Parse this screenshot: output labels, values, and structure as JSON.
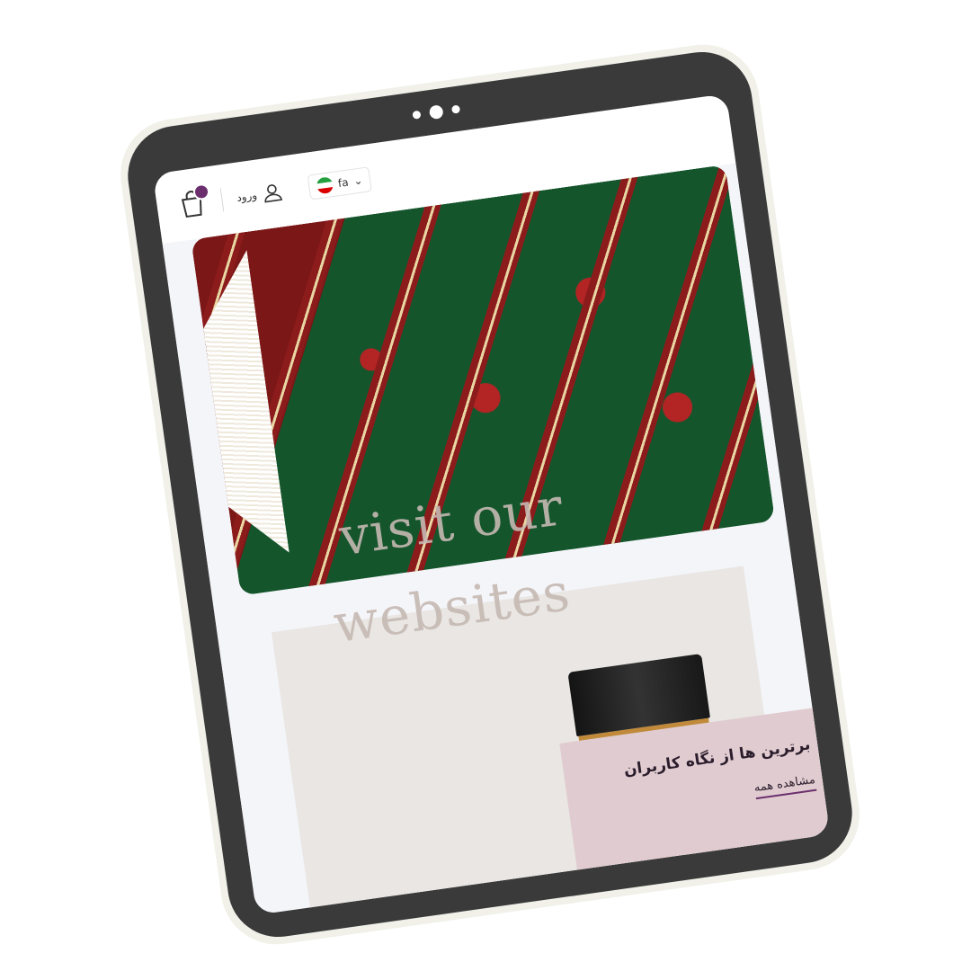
{
  "header": {
    "language": "fa",
    "login_label": "ورود",
    "icons": {
      "cart": "shopping-bag-icon",
      "user": "user-icon",
      "flag": "iran-flag-icon",
      "chevron": "chevron-down-icon"
    }
  },
  "hero": {
    "watermark_line1": "visit our",
    "watermark_line2": "websites"
  },
  "promo": {
    "title": "برترین ها از نگاه کاربران",
    "link": "مشاهده همه"
  },
  "colors": {
    "device": "#3a3a3a",
    "accent": "#6b2f6e",
    "promo_bg": "#e0ccd0"
  }
}
